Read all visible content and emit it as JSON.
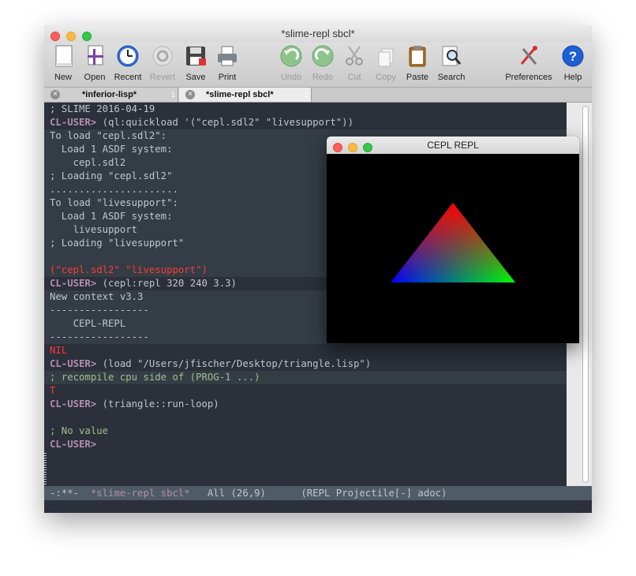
{
  "window": {
    "title": "*slime-repl sbcl*"
  },
  "toolbar": {
    "new": "New",
    "open": "Open",
    "recent": "Recent",
    "revert": "Revert",
    "save": "Save",
    "print": "Print",
    "undo": "Undo",
    "redo": "Redo",
    "cut": "Cut",
    "copy": "Copy",
    "paste": "Paste",
    "search": "Search",
    "preferences": "Preferences",
    "help": "Help"
  },
  "tabs": [
    {
      "name": "*inferior-lisp*",
      "num": "1"
    },
    {
      "name": "*slime-repl sbcl*",
      "num": "2"
    }
  ],
  "repl": {
    "lines": [
      "; SLIME 2016-04-19",
      "CL-USER>",
      " (ql:quickload '(\"cepl.sdl2\" \"livesupport\"))",
      "To load \"cepl.sdl2\":",
      "  Load 1 ASDF system:",
      "    cepl.sdl2",
      "; Loading \"cepl.sdl2\"",
      "......................",
      "To load \"livesupport\":",
      "  Load 1 ASDF system:",
      "    livesupport",
      "; Loading \"livesupport\"",
      "(\"cepl.sdl2\" \"livesupport\")",
      " (cepl:repl 320 240 3.3)",
      "New context v3.3",
      "-----------------",
      "    CEPL-REPL",
      "-----------------",
      "NIL",
      " (load \"/Users/jfischer/Desktop/triangle.lisp\")",
      "; recompile cpu side of (PROG-1 ...)",
      "T",
      " (triangle::run-loop)",
      "; No value"
    ]
  },
  "modeline": {
    "status": "-:**-  ",
    "buffer": "*slime-repl sbcl*",
    "position": "   All (26,9)      (REPL Projectile[-] adoc)"
  },
  "cepl_window": {
    "title": "CEPL REPL"
  },
  "colors": {
    "bg": "#2b303b",
    "prompt": "#b48ead",
    "error": "#ff3b30",
    "comment": "#a3be8c"
  }
}
